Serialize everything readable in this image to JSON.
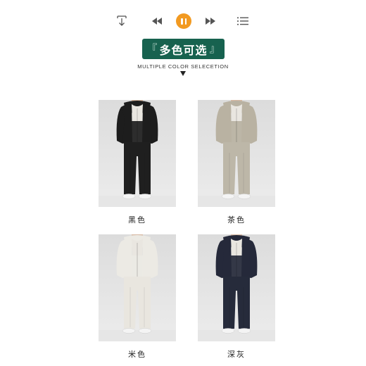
{
  "player": {
    "icons": [
      "download-icon",
      "previous-icon",
      "pause-icon",
      "next-icon",
      "playlist-icon"
    ],
    "accent_color": "#f29a21"
  },
  "banner": {
    "title": "多色可选",
    "bracket_left": "『",
    "bracket_right": "』",
    "subtitle": "MULTIPLE COLOR SELECETION",
    "background_color": "#17624f"
  },
  "products": [
    {
      "label": "黑色",
      "hoodie_color": "#1d1d1d",
      "pants_color": "#1f1f1f"
    },
    {
      "label": "茶色",
      "hoodie_color": "#b9b2a2",
      "pants_color": "#bdb7a8"
    },
    {
      "label": "米色",
      "hoodie_color": "#eceae4",
      "pants_color": "#e9e6df"
    },
    {
      "label": "深灰",
      "hoodie_color": "#25293a",
      "pants_color": "#262b3b"
    }
  ]
}
